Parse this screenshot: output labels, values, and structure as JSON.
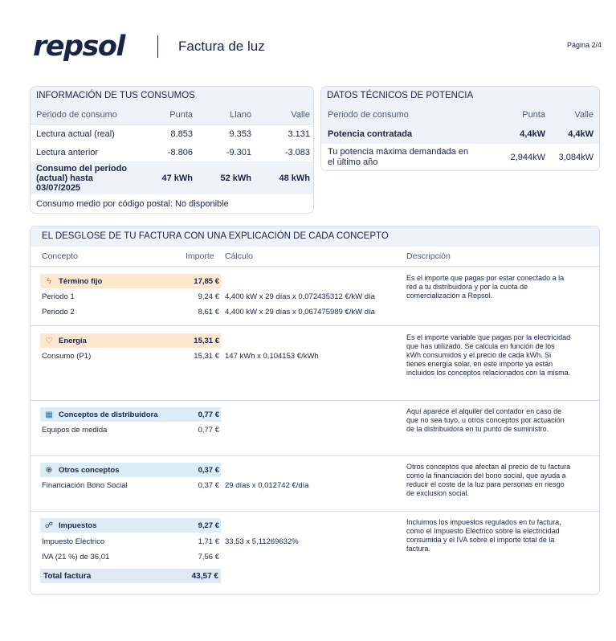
{
  "header": {
    "brand": "repsol",
    "title": "Factura de luz",
    "page": "Página 2/4"
  },
  "consumos": {
    "title": "INFORMACIÓN DE TUS CONSUMOS",
    "columns": [
      "Periodo de consumo",
      "Punta",
      "Llano",
      "Valle"
    ],
    "rows": [
      {
        "label": "Lectura actual (real)",
        "punta": "8.853",
        "llano": "9.353",
        "valle": "3.131"
      },
      {
        "label": "Lectura anterior",
        "punta": "-8.806",
        "llano": "-9.301",
        "valle": "-3.083"
      },
      {
        "label": "Consumo del periodo (actual) hasta 03/07/2025",
        "punta": "47 kWh",
        "llano": "52 kWh",
        "valle": "48 kWh"
      }
    ],
    "note": "Consumo medio por código postal: No disponible"
  },
  "potencia": {
    "title": "DATOS TÉCNICOS DE POTENCIA",
    "columns": [
      "Periodo de consumo",
      "Punta",
      "Valle"
    ],
    "rows": [
      {
        "label": "Potencia contratada",
        "punta": "4,4kW",
        "valle": "4,4kW"
      },
      {
        "label": "Tu potencia máxima demandada en el último año",
        "punta": "2,944kW",
        "valle": "3,084kW"
      }
    ]
  },
  "desglose": {
    "title": "EL DESGLOSE DE TU FACTURA CON UNA EXPLICACIÓN DE CADA CONCEPTO",
    "columns": [
      "Concepto",
      "Importe",
      "Cálculo",
      "Descripción"
    ],
    "sections": [
      {
        "name": "Término fijo",
        "amount": "17,85 €",
        "icon": "lightning-icon",
        "color": "#fde7cf",
        "lines": [
          {
            "label": "Periodo 1",
            "amount": "9,24 €",
            "calc": "4,400 kW x 29 días x 0,072435312 €/kW día"
          },
          {
            "label": "Periodo 2",
            "amount": "8,61 €",
            "calc": "4,400 kW x 29 días x 0,067475989 €/kW día"
          }
        ],
        "description": "Es el importe que pagas por estar conectado a la red a tu distribuidora y por la cuota de comercialización a Repsol."
      },
      {
        "name": "Energía",
        "amount": "15,31 €",
        "icon": "lightbulb-icon",
        "color": "#fde7cf",
        "lines": [
          {
            "label": "Consumo (P1)",
            "amount": "15,31 €",
            "calc": "147 kWh x 0,104153 €/kWh"
          }
        ],
        "description": "Es el importe variable que pagas por la electricidad que has utilizado. Se calcula en función de los kWh consumidos y el precio de cada kWh. Si tienes energía solar, en este importe ya están incluidos los conceptos relacionados con la misma."
      },
      {
        "name": "Conceptos de distribuidora",
        "amount": "0,77 €",
        "icon": "grid-icon",
        "color": "#dcedf7",
        "lines": [
          {
            "label": "Equipos de medida",
            "amount": "0,77 €",
            "calc": ""
          }
        ],
        "description": "Aquí aparece el alquiler del contador en caso de que no sea tuyo, u otros conceptos por actuación de la distribuidora en tu punto de suministro."
      },
      {
        "name": "Otros conceptos",
        "amount": "0,37 €",
        "icon": "plus-circle-icon",
        "color": "#dcedf7",
        "lines": [
          {
            "label": "Financiación Bono Social",
            "amount": "0,37 €",
            "calc": "29 días x 0,012742 €/día"
          }
        ],
        "description": "Otros conceptos que afectan al precio de tu factura como la financiación del bono social, que ayuda a reducir el coste de la luz para personas en riesgo de exclusion social."
      },
      {
        "name": "Impuestos",
        "amount": "9,27 €",
        "icon": "hand-coin-icon",
        "color": "#dcedf7",
        "lines": [
          {
            "label": "Impuesto Eléctrico",
            "amount": "1,71 €",
            "calc": "33,53 x 5,11269632%"
          },
          {
            "label": "IVA (21 %) de 36,01",
            "amount": "7,56 €",
            "calc": ""
          }
        ],
        "description": "Incluimos los impuestos regulados en tu factura, como el Impuesto Eléctrico sobre la electricidad consumida y el IVA sobre el importe total de la factura."
      }
    ],
    "total": {
      "label": "Total factura",
      "amount": "43,57 €"
    }
  }
}
